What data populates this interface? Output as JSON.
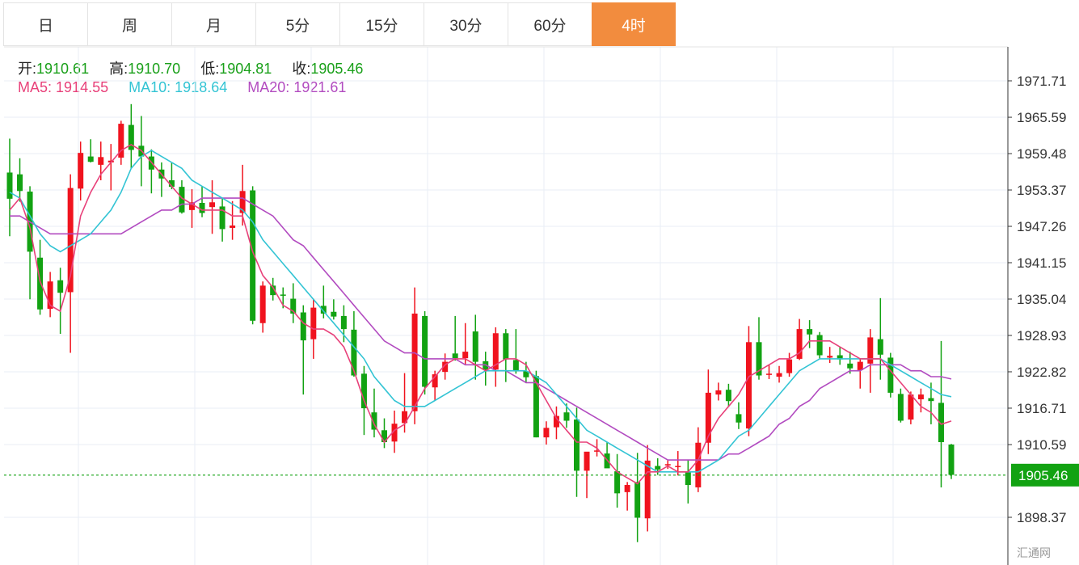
{
  "tabs": [
    {
      "label": "日",
      "active": false
    },
    {
      "label": "周",
      "active": false
    },
    {
      "label": "月",
      "active": false
    },
    {
      "label": "5分",
      "active": false
    },
    {
      "label": "15分",
      "active": false
    },
    {
      "label": "30分",
      "active": false
    },
    {
      "label": "60分",
      "active": false
    },
    {
      "label": "4时",
      "active": true
    }
  ],
  "ohlc_info": {
    "open_label": "开:",
    "open": "1910.61",
    "high_label": "高:",
    "high": "1910.70",
    "low_label": "低:",
    "low": "1904.81",
    "close_label": "收:",
    "close": "1905.46"
  },
  "ma_info": {
    "ma5_label": "MA5:",
    "ma5": "1914.55",
    "ma10_label": "MA10:",
    "ma10": "1918.64",
    "ma20_label": "MA20:",
    "ma20": "1921.61"
  },
  "watermark": "汇通网",
  "colors": {
    "up": "#f0131e",
    "down": "#12a212",
    "ma5": "#e8417a",
    "ma10": "#33c4d4",
    "ma20": "#b24bc0",
    "accent": "#f28c3e",
    "price_tag": "#12a212",
    "grid": "#e8eef5"
  },
  "chart_data": {
    "type": "candlestick",
    "ylim": [
      1893,
      1977
    ],
    "y_ticks": [
      "1971.71",
      "1965.59",
      "1959.48",
      "1953.37",
      "1947.26",
      "1941.15",
      "1935.04",
      "1928.93",
      "1922.82",
      "1916.71",
      "1910.59",
      "1898.37"
    ],
    "last_price": "1905.46",
    "candles": [
      [
        1956.3,
        1962.0,
        1945.6,
        1951.9
      ],
      [
        1956.0,
        1958.7,
        1951.4,
        1953.2
      ],
      [
        1953.1,
        1954.0,
        1935.0,
        1943.0
      ],
      [
        1942.0,
        1945.0,
        1932.4,
        1933.3
      ],
      [
        1933.4,
        1939.6,
        1932.0,
        1938.0
      ],
      [
        1938.2,
        1940.3,
        1929.2,
        1936.1
      ],
      [
        1936.2,
        1956.0,
        1926.0,
        1953.7
      ],
      [
        1953.6,
        1961.5,
        1951.6,
        1959.6
      ],
      [
        1959.0,
        1961.9,
        1958.0,
        1958.1
      ],
      [
        1957.6,
        1961.5,
        1955.0,
        1958.9
      ],
      [
        1958.0,
        1961.1,
        1953.3,
        1958.3
      ],
      [
        1958.8,
        1965.0,
        1957.6,
        1964.5
      ],
      [
        1964.3,
        1967.8,
        1957.0,
        1960.1
      ],
      [
        1960.8,
        1965.8,
        1954.0,
        1959.0
      ],
      [
        1959.0,
        1960.2,
        1952.8,
        1956.8
      ],
      [
        1956.8,
        1958.0,
        1952.2,
        1955.3
      ],
      [
        1955.0,
        1958.0,
        1953.5,
        1953.9
      ],
      [
        1953.9,
        1955.0,
        1949.4,
        1949.6
      ],
      [
        1950.0,
        1953.5,
        1947.0,
        1951.3
      ],
      [
        1951.2,
        1954.0,
        1948.8,
        1949.5
      ],
      [
        1950.5,
        1955.0,
        1946.0,
        1951.3
      ],
      [
        1950.6,
        1952.0,
        1944.7,
        1946.8
      ],
      [
        1947.0,
        1951.5,
        1945.0,
        1947.4
      ],
      [
        1949.5,
        1957.6,
        1947.4,
        1953.2
      ],
      [
        1953.3,
        1954.0,
        1930.8,
        1931.4
      ],
      [
        1931.0,
        1938.0,
        1929.4,
        1937.3
      ],
      [
        1937.3,
        1938.6,
        1934.8,
        1935.7
      ],
      [
        1935.8,
        1937.0,
        1933.5,
        1935.6
      ],
      [
        1935.1,
        1937.7,
        1931.0,
        1932.6
      ],
      [
        1932.8,
        1934.0,
        1919.0,
        1928.1
      ],
      [
        1928.3,
        1935.1,
        1925.0,
        1933.6
      ],
      [
        1933.9,
        1937.3,
        1931.8,
        1932.6
      ],
      [
        1932.9,
        1935.0,
        1931.6,
        1932.1
      ],
      [
        1932.2,
        1934.0,
        1927.8,
        1930.0
      ],
      [
        1929.9,
        1933.0,
        1922.0,
        1922.2
      ],
      [
        1922.5,
        1923.8,
        1912.2,
        1916.7
      ],
      [
        1916.0,
        1920.0,
        1911.8,
        1913.1
      ],
      [
        1913.0,
        1915.0,
        1910.0,
        1911.0
      ],
      [
        1911.1,
        1916.3,
        1909.2,
        1914.1
      ],
      [
        1914.2,
        1922.6,
        1912.6,
        1916.2
      ],
      [
        1916.2,
        1937.0,
        1914.0,
        1932.6
      ],
      [
        1932.2,
        1933.0,
        1919.0,
        1920.3
      ],
      [
        1920.2,
        1923.0,
        1918.0,
        1922.4
      ],
      [
        1922.8,
        1925.9,
        1921.5,
        1924.5
      ],
      [
        1925.9,
        1932.2,
        1924.7,
        1925.1
      ],
      [
        1925.1,
        1931.0,
        1924.0,
        1926.2
      ],
      [
        1929.6,
        1932.4,
        1921.5,
        1924.5
      ],
      [
        1924.6,
        1926.2,
        1920.5,
        1923.2
      ],
      [
        1923.2,
        1930.3,
        1920.3,
        1929.3
      ],
      [
        1929.3,
        1930.0,
        1921.1,
        1924.9
      ],
      [
        1924.8,
        1930.0,
        1922.5,
        1923.0
      ],
      [
        1922.9,
        1924.5,
        1921.0,
        1921.9
      ],
      [
        1922.1,
        1923.0,
        1911.8,
        1911.8
      ],
      [
        1911.8,
        1914.5,
        1910.6,
        1913.4
      ],
      [
        1913.5,
        1917.0,
        1911.5,
        1915.4
      ],
      [
        1916.0,
        1917.5,
        1913.4,
        1914.6
      ],
      [
        1914.8,
        1916.8,
        1901.8,
        1906.2
      ],
      [
        1906.2,
        1908.0,
        1901.6,
        1909.4
      ],
      [
        1909.4,
        1911.5,
        1908.6,
        1909.6
      ],
      [
        1909.1,
        1911.0,
        1907.0,
        1906.6
      ],
      [
        1906.1,
        1909.0,
        1900.0,
        1902.4
      ],
      [
        1902.6,
        1904.3,
        1899.5,
        1903.8
      ],
      [
        1904.3,
        1909.2,
        1894.2,
        1898.3
      ],
      [
        1898.2,
        1910.5,
        1896.0,
        1907.9
      ],
      [
        1907.0,
        1908.3,
        1905.5,
        1906.4
      ],
      [
        1907.1,
        1908.0,
        1906.5,
        1907.3
      ],
      [
        1907.0,
        1909.5,
        1905.4,
        1907.0
      ],
      [
        1906.0,
        1908.0,
        1900.7,
        1903.8
      ],
      [
        1903.4,
        1913.5,
        1902.6,
        1910.9
      ],
      [
        1910.9,
        1923.2,
        1909.0,
        1919.3
      ],
      [
        1919.0,
        1921.0,
        1918.0,
        1919.7
      ],
      [
        1919.8,
        1920.8,
        1916.9,
        1917.9
      ],
      [
        1915.7,
        1917.7,
        1913.2,
        1914.3
      ],
      [
        1913.3,
        1930.5,
        1912.0,
        1927.8
      ],
      [
        1927.8,
        1932.0,
        1921.5,
        1922.2
      ],
      [
        1922.4,
        1924.0,
        1921.6,
        1922.5
      ],
      [
        1922.0,
        1923.8,
        1921.0,
        1922.6
      ],
      [
        1922.6,
        1926.0,
        1922.0,
        1924.9
      ],
      [
        1925.0,
        1931.7,
        1924.8,
        1930.0
      ],
      [
        1930.0,
        1931.5,
        1926.8,
        1929.1
      ],
      [
        1929.0,
        1929.5,
        1925.0,
        1925.6
      ],
      [
        1925.2,
        1927.0,
        1924.3,
        1925.5
      ],
      [
        1925.6,
        1927.0,
        1924.0,
        1924.9
      ],
      [
        1924.2,
        1926.2,
        1922.5,
        1923.4
      ],
      [
        1923.1,
        1925.0,
        1920.0,
        1924.5
      ],
      [
        1924.2,
        1930.0,
        1919.3,
        1928.6
      ],
      [
        1928.3,
        1935.2,
        1921.5,
        1925.7
      ],
      [
        1925.2,
        1926.0,
        1918.5,
        1919.3
      ],
      [
        1919.1,
        1920.0,
        1914.3,
        1914.6
      ],
      [
        1914.8,
        1919.5,
        1914.0,
        1919.0
      ],
      [
        1918.2,
        1920.0,
        1916.0,
        1919.0
      ],
      [
        1918.4,
        1921.0,
        1914.0,
        1917.9
      ],
      [
        1917.6,
        1928.0,
        1903.4,
        1911.0
      ],
      [
        1910.6,
        1910.7,
        1904.8,
        1905.5
      ]
    ],
    "ma5": [
      1950,
      1952,
      1947,
      1938,
      1934,
      1933,
      1939,
      1949,
      1953,
      1956,
      1958,
      1960,
      1961,
      1960,
      1958,
      1956,
      1954,
      1952,
      1951,
      1950,
      1950,
      1950,
      1949,
      1949,
      1943,
      1939,
      1937,
      1934,
      1933,
      1931,
      1930,
      1930,
      1929,
      1927,
      1923,
      1918,
      1914,
      1911,
      1913,
      1914,
      1917,
      1920,
      1922,
      1924,
      1925,
      1925,
      1924,
      1923,
      1924,
      1925,
      1925,
      1924,
      1921,
      1918,
      1915,
      1913,
      1911,
      1911,
      1910,
      1908,
      1906,
      1905,
      1904,
      1906,
      1906,
      1907,
      1906,
      1906,
      1908,
      1912,
      1915,
      1917,
      1919,
      1922,
      1923,
      1924,
      1925,
      1925,
      1926,
      1928,
      1928,
      1928,
      1927,
      1926,
      1925,
      1925,
      1925,
      1923,
      1921,
      1919,
      1917,
      1916,
      1914,
      1914.55
    ],
    "ma10": [
      1953,
      1952,
      1949,
      1946,
      1944,
      1943,
      1944,
      1945,
      1946,
      1948,
      1950,
      1953,
      1957,
      1959,
      1960,
      1959,
      1958,
      1957,
      1955,
      1954,
      1953,
      1952,
      1951,
      1950,
      1948,
      1945,
      1943,
      1941,
      1939,
      1937,
      1935,
      1933,
      1931,
      1929,
      1927,
      1925,
      1922,
      1920,
      1918,
      1917,
      1917,
      1917,
      1918,
      1919,
      1920,
      1921,
      1922,
      1923,
      1923,
      1923,
      1923,
      1923,
      1922,
      1921,
      1919,
      1917,
      1915,
      1913,
      1912,
      1911,
      1910,
      1909,
      1908,
      1907,
      1906,
      1906,
      1906,
      1906,
      1906,
      1907,
      1908,
      1910,
      1912,
      1913,
      1915,
      1917,
      1919,
      1921,
      1923,
      1924,
      1925,
      1925,
      1925,
      1925,
      1925,
      1925,
      1925,
      1924,
      1923,
      1922,
      1921,
      1920,
      1919,
      1918.64
    ],
    "ma20": [
      1949,
      1949,
      1948,
      1947,
      1946,
      1946,
      1946,
      1946,
      1946,
      1946,
      1946,
      1946,
      1947,
      1948,
      1949,
      1950,
      1950,
      1951,
      1951,
      1952,
      1952,
      1952,
      1952,
      1952,
      1951,
      1950,
      1949,
      1947,
      1945,
      1944,
      1942,
      1940,
      1938,
      1936,
      1934,
      1932,
      1930,
      1928,
      1927,
      1926,
      1926,
      1925,
      1925,
      1925,
      1925,
      1924,
      1924,
      1924,
      1923,
      1923,
      1922,
      1921,
      1921,
      1920,
      1919,
      1918,
      1917,
      1916,
      1915,
      1914,
      1913,
      1912,
      1911,
      1910,
      1909,
      1908,
      1908,
      1908,
      1908,
      1908,
      1908,
      1909,
      1909,
      1910,
      1911,
      1912,
      1914,
      1915,
      1917,
      1918,
      1920,
      1921,
      1922,
      1923,
      1923,
      1924,
      1924,
      1924,
      1924,
      1923,
      1923,
      1922,
      1922,
      1921.61
    ]
  }
}
